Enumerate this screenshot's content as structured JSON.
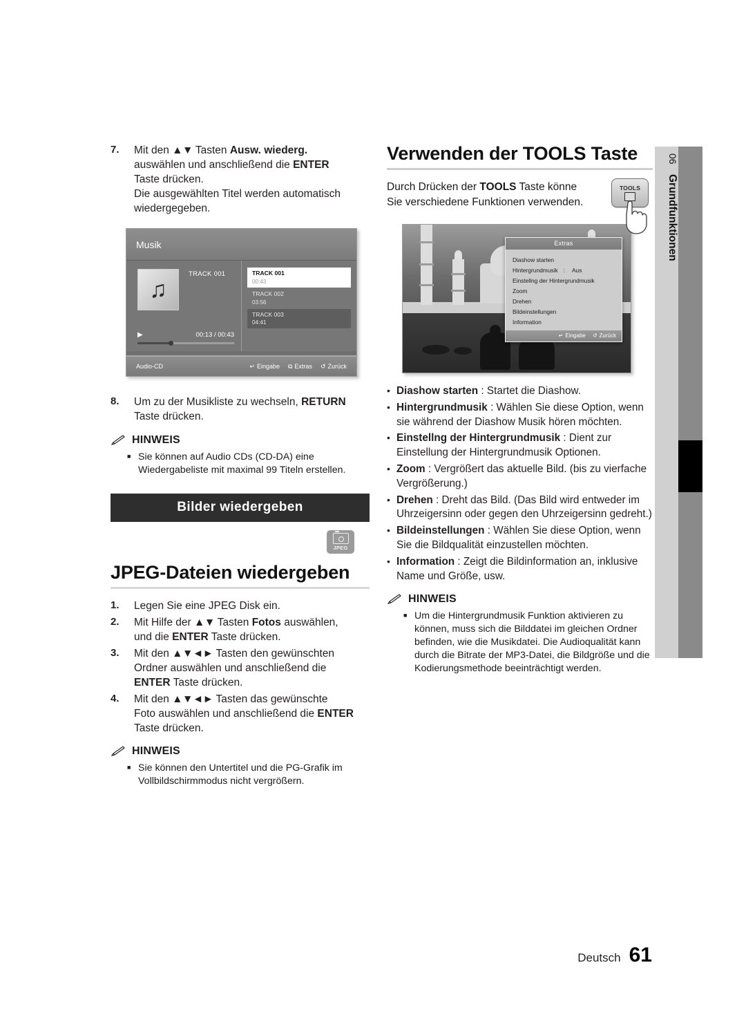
{
  "page": {
    "language_label": "Deutsch",
    "page_number": "61",
    "side_tab": {
      "chapter_number": "06",
      "chapter_name": "Grundfunktionen"
    }
  },
  "left_column": {
    "step7": {
      "num": "7.",
      "line1_pre": "Mit den ",
      "line1_arrows": "▲▼",
      "line1_mid": " Tasten ",
      "line1_bold": "Ausw. wiederg.",
      "line2_pre": "auswählen und anschließend die ",
      "line2_bold": "ENTER",
      "line3": "Taste drücken.",
      "line4": "Die ausgewählten Titel werden automatisch",
      "line5": "wiedergegeben."
    },
    "music_screenshot": {
      "title": "Musik",
      "now_playing_title": "TRACK 001",
      "elapsed_total": "00:13 / 00:43",
      "play_icon": "▶",
      "note_icon": "♫",
      "source_label": "Audio-CD",
      "tracks": [
        {
          "name": "TRACK 001",
          "time": "00:43",
          "state": "selected"
        },
        {
          "name": "TRACK 002",
          "time": "03:56",
          "state": "normal"
        },
        {
          "name": "TRACK 003",
          "time": "04:41",
          "state": "highlighted"
        }
      ],
      "keys": [
        {
          "icon": "↵",
          "label": "Eingabe"
        },
        {
          "icon": "⧉",
          "label": "Extras"
        },
        {
          "icon": "↺",
          "label": "Zurück"
        }
      ]
    },
    "step8": {
      "num": "8.",
      "line1_pre": "Um zu der Musikliste zu wechseln, ",
      "line1_bold": "RETURN",
      "line2": "Taste drücken."
    },
    "note1": {
      "label": "HINWEIS",
      "items": [
        "Sie können auf Audio CDs (CD-DA) eine Wiedergabeliste mit maximal 99 Titeln erstellen."
      ]
    },
    "banner": "Bilder wiedergeben",
    "jpeg_badge_label": "JPEG",
    "heading": "JPEG-Dateien wiedergeben",
    "jpeg_steps": [
      {
        "num": "1.",
        "html": "Legen Sie eine JPEG Disk ein."
      },
      {
        "num": "2.",
        "pre": "Mit Hilfe der ",
        "arrows": "▲▼",
        "mid": " Tasten ",
        "bold": "Fotos",
        "post": " auswählen,",
        "line2_pre": "und die ",
        "line2_bold": "ENTER",
        "line2_post": " Taste drücken."
      },
      {
        "num": "3.",
        "pre": "Mit den ",
        "arrows": "▲▼◄►",
        "mid": " Tasten den gewünschten",
        "line2": "Ordner auswählen und anschließend die",
        "line3_bold": "ENTER",
        "line3_post": " Taste drücken."
      },
      {
        "num": "4.",
        "pre": "Mit den ",
        "arrows": "▲▼◄►",
        "mid": " Tasten das gewünschte",
        "line2_pre": "Foto auswählen und anschließend die ",
        "line2_bold": "ENTER",
        "line3": "Taste drücken."
      }
    ],
    "note2": {
      "label": "HINWEIS",
      "items": [
        "Sie können den Untertitel und die PG-Grafik im Vollbildschirmmodus nicht vergrößern."
      ]
    }
  },
  "right_column": {
    "heading": "Verwenden der TOOLS Taste",
    "intro_pre": "Durch Drücken der ",
    "intro_bold": "TOOLS",
    "intro_post": " Taste könne",
    "intro_line2": "Sie verschiedene Funktionen verwenden.",
    "tools_key_label": "TOOLS",
    "photo_screenshot": {
      "menu_title": "Extras",
      "menu_items": [
        {
          "label": "Diashow starten",
          "value": ""
        },
        {
          "label": "Hintergrundmusik",
          "colon": ":",
          "value": "Aus"
        },
        {
          "label": "Einstellng der Hintergrundmusik",
          "value": ""
        },
        {
          "label": "Zoom",
          "value": ""
        },
        {
          "label": "Drehen",
          "value": ""
        },
        {
          "label": "Bildeinstellungen",
          "value": ""
        },
        {
          "label": "Information",
          "value": ""
        }
      ],
      "keys": [
        {
          "icon": "↵",
          "label": "Eingabe"
        },
        {
          "icon": "↺",
          "label": "Zurück"
        }
      ]
    },
    "bullets": [
      {
        "bold": "Diashow starten",
        "sep": " : ",
        "text": "Startet die Diashow."
      },
      {
        "bold": "Hintergrundmusik",
        "sep": " : ",
        "text": "Wählen Sie diese Option, wenn sie während der Diashow Musik hören möchten."
      },
      {
        "bold": "Einstellng der Hintergrundmusik",
        "sep": " : ",
        "text": "Dient zur Einstellung der Hintergrundmusik Optionen."
      },
      {
        "bold": "Zoom",
        "sep": " : ",
        "text": "Vergrößert das aktuelle Bild. (bis zu vierfache Vergrößerung.)"
      },
      {
        "bold": "Drehen",
        "sep": " : ",
        "text": "Dreht das Bild. (Das Bild wird entweder im Uhrzeigersinn oder gegen den Uhrzeigersinn gedreht.)"
      },
      {
        "bold": "Bildeinstellungen",
        "sep": " : ",
        "text": "Wählen Sie diese Option, wenn Sie die Bildqualität einzustellen möchten."
      },
      {
        "bold": "Information",
        "sep": " : ",
        "text": "Zeigt die Bildinformation an, inklusive Name und Größe, usw."
      }
    ],
    "note": {
      "label": "HINWEIS",
      "items": [
        "Um die Hintergrundmusik Funktion aktivieren zu können, muss sich die Bilddatei im gleichen Ordner befinden, wie die Musikdatei. Die Audioqualität kann durch die Bitrate der MP3-Datei, die Bildgröße und die Kodierungsmethode beeinträchtigt werden."
      ]
    }
  }
}
